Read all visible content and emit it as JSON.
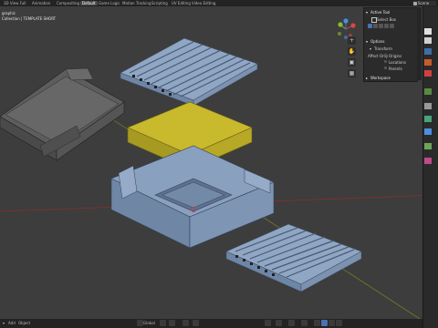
{
  "workspace_tabs": [
    {
      "label": "3D View Full",
      "active": false
    },
    {
      "label": "Animation",
      "active": false
    },
    {
      "label": "Compositing",
      "active": false
    },
    {
      "label": "Default",
      "active": true
    },
    {
      "label": "Game Logic",
      "active": false
    },
    {
      "label": "Motion Tracking",
      "active": false
    },
    {
      "label": "Scripting",
      "active": false
    },
    {
      "label": "UV Editing",
      "active": false
    },
    {
      "label": "Video Editing",
      "active": false
    }
  ],
  "scene": {
    "label": "Scene"
  },
  "viewport": {
    "view_name": "graphic",
    "collection_info": "Collection | TEMPLATE SHORT"
  },
  "tool_panel": {
    "active_tool_header": "Active Tool",
    "select_box": "Select Box",
    "options_header": "Options",
    "transform_header": "Transform",
    "affect_only_label": "Affect Only",
    "origins": "Origins",
    "locations": "Locations",
    "parents": "Parents",
    "workspace_header": "Workspace"
  },
  "statusbar": {
    "add": "Add",
    "object": "Object",
    "transform_orientation": "Global"
  },
  "colors": {
    "accent": "#4772b3",
    "viewport_bg": "#3d3d3d",
    "case_blue": "#8aa1c0",
    "battery_yellow": "#c6b62a",
    "shell_grey": "#5a5a5a"
  },
  "icons": [
    "view-axis-x-icon",
    "view-axis-y-icon",
    "view-axis-z-icon",
    "zoom-icon",
    "hand-pan-icon",
    "camera-view-icon",
    "perspective-grid-icon",
    "select-box-icon",
    "transform-icon",
    "scene-icon"
  ]
}
